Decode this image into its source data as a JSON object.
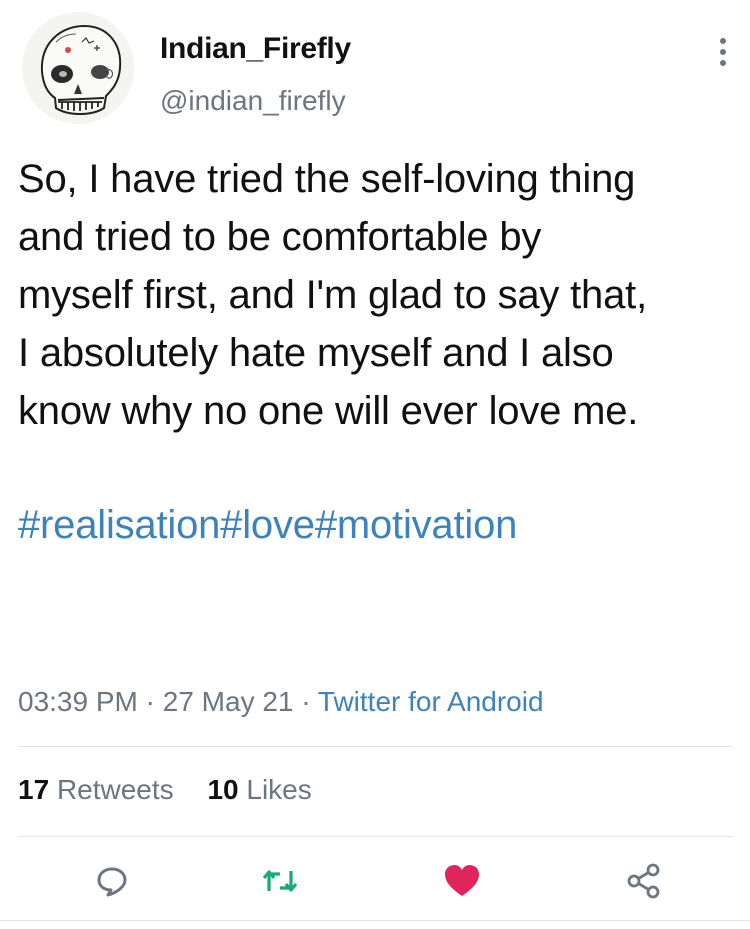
{
  "user": {
    "display_name": "Indian_Firefly",
    "handle": "@indian_firefly",
    "avatar_icon": "skull-sketch-avatar"
  },
  "tweet": {
    "lines": [
      "So, I have tried the self-loving thing",
      "and tried to be comfortable by",
      "myself first, and I'm glad to say that,",
      "I absolutely hate myself and I also",
      "know why no one will ever love me."
    ],
    "hashtags": [
      "#realisation",
      "#love",
      "#motivation"
    ]
  },
  "meta": {
    "time": "03:39 PM",
    "sep1": " · ",
    "date": "27 May 21",
    "sep2": " · ",
    "source": "Twitter for Android"
  },
  "stats": {
    "retweets_count": "17",
    "retweets_label": "Retweets",
    "likes_count": "10",
    "likes_label": "Likes"
  },
  "actions": {
    "reply_icon": "comment-icon",
    "retweet_icon": "retweet-icon",
    "like_icon": "heart-icon",
    "share_icon": "share-icon"
  },
  "colors": {
    "link": "#3e82bd",
    "retweet": "#18a87a",
    "like": "#e0245e",
    "muted": "#6b7681"
  }
}
